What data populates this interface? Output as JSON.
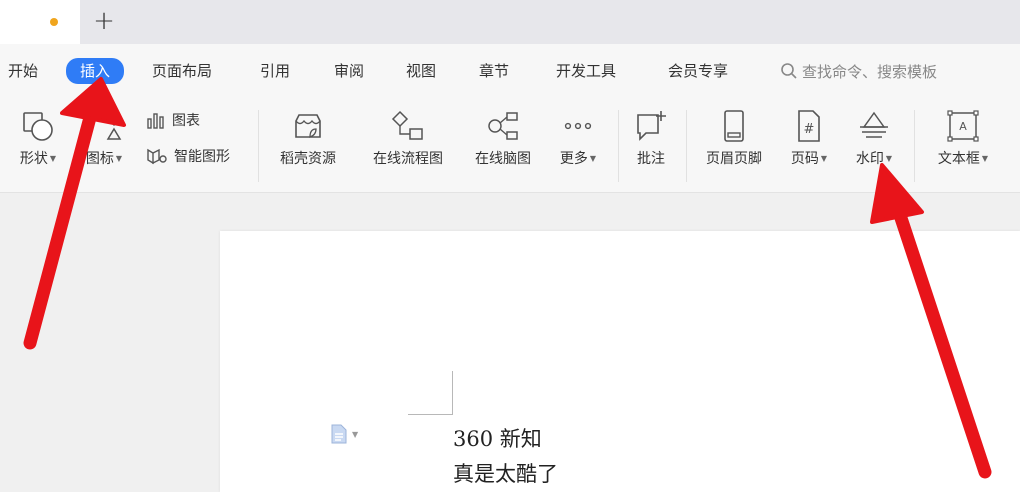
{
  "tabbar": {
    "new_tab": "+"
  },
  "menu": {
    "items": [
      "开始",
      "插入",
      "页面布局",
      "引用",
      "审阅",
      "视图",
      "章节",
      "开发工具",
      "会员专享"
    ],
    "active_index": 1,
    "search_placeholder": "查找命令、搜索模板"
  },
  "ribbon": {
    "shape": "形状",
    "icon_lib": "图标",
    "chart": "图表",
    "smart_art": "智能图形",
    "docer": "稻壳资源",
    "flowchart": "在线流程图",
    "mindmap": "在线脑图",
    "more": "更多",
    "comment": "批注",
    "header_footer": "页眉页脚",
    "page_number": "页码",
    "watermark": "水印",
    "textbox": "文本框"
  },
  "document": {
    "lines": [
      "360 新知",
      "真是太酷了"
    ]
  },
  "colors": {
    "accent": "#2f7cf6",
    "arrow": "#e8141a",
    "tab_dot": "#f0a51e"
  }
}
